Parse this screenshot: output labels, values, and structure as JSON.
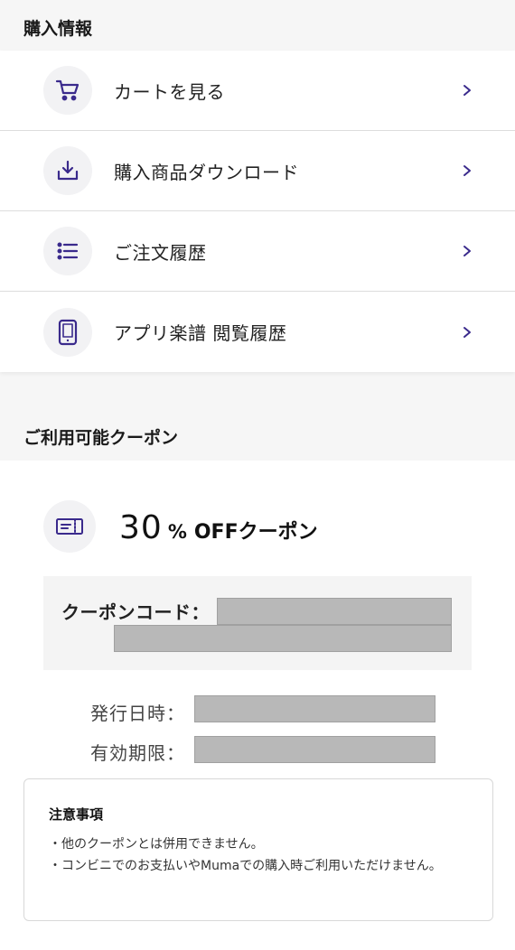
{
  "purchase_section": {
    "title": "購入情報",
    "items": [
      {
        "label": "カートを見る",
        "icon": "cart-icon"
      },
      {
        "label": "購入商品ダウンロード",
        "icon": "download-icon"
      },
      {
        "label": "ご注文履歴",
        "icon": "list-icon"
      },
      {
        "label": "アプリ楽譜 閲覧履歴",
        "icon": "tablet-icon"
      }
    ],
    "chevron": ">"
  },
  "coupon_section": {
    "title": "ご利用可能クーポン",
    "coupon": {
      "discount_value": "30",
      "discount_unit": "%",
      "discount_text": "OFFクーポン",
      "code_label": "クーポンコード：",
      "issued_label": "発行日時：",
      "expiry_label": "有効期限："
    },
    "notes": {
      "title": "注意事項",
      "items": [
        "・他のクーポンとは併用できません。",
        "・コンビニでのお支払いやMumaでの購入時ご利用いただけません。"
      ]
    }
  },
  "colors": {
    "accent": "#3a2a8c",
    "icon_bg": "#f2f2f4",
    "redacted": "#b8b8b8"
  }
}
